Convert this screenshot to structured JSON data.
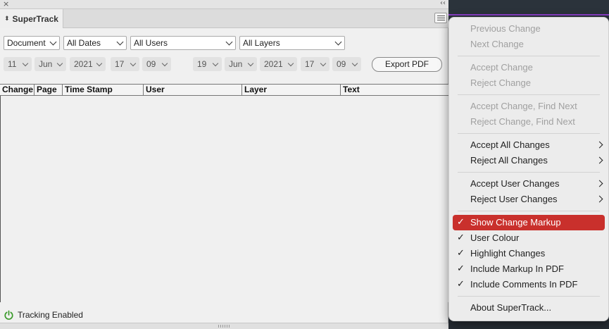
{
  "topbar": {
    "close": "×",
    "collapse": "‹‹"
  },
  "tab": {
    "arrows": "⬍",
    "title": "SuperTrack"
  },
  "filters": {
    "scope": "Document",
    "dates": "All Dates",
    "users": "All Users",
    "layers": "All Layers"
  },
  "date_from": {
    "day": "11",
    "month": "Jun",
    "year": "2021",
    "hour": "17",
    "minute": "09"
  },
  "date_to": {
    "day": "19",
    "month": "Jun",
    "year": "2021",
    "hour": "17",
    "minute": "09"
  },
  "export_label": "Export PDF",
  "table": {
    "columns": [
      "Change",
      "Page",
      "Time Stamp",
      "User",
      "Layer",
      "Text"
    ]
  },
  "status": {
    "text": "Tracking Enabled",
    "icon": "power-icon",
    "color": "#3a9a2a"
  },
  "menu": {
    "check_glyph": "✓",
    "items": [
      {
        "label": "Previous Change",
        "disabled": true
      },
      {
        "label": "Next Change",
        "disabled": true
      },
      {
        "label": "Accept Change",
        "disabled": true
      },
      {
        "label": "Reject Change",
        "disabled": true
      },
      {
        "label": "Accept Change, Find Next",
        "disabled": true
      },
      {
        "label": "Reject Change, Find Next",
        "disabled": true
      },
      {
        "label": "Accept All Changes",
        "submenu": true
      },
      {
        "label": "Reject All Changes",
        "submenu": true
      },
      {
        "label": "Accept User Changes",
        "submenu": true
      },
      {
        "label": "Reject User Changes",
        "submenu": true
      },
      {
        "label": "Show Change Markup",
        "checked": true,
        "selected": true
      },
      {
        "label": "User Colour",
        "checked": true
      },
      {
        "label": "Highlight Changes",
        "checked": true
      },
      {
        "label": "Include Markup In PDF",
        "checked": true
      },
      {
        "label": "Include Comments In PDF",
        "checked": true
      },
      {
        "label": "About SuperTrack..."
      }
    ]
  },
  "colors": {
    "highlight": "#c9302c",
    "accent_stripe": "#8a3fc6"
  }
}
